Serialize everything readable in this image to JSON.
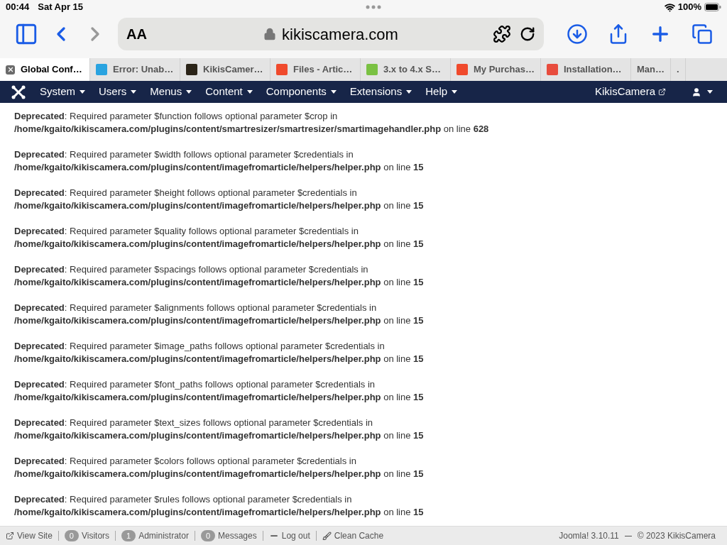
{
  "status_bar": {
    "time": "00:44",
    "date": "Sat Apr 15",
    "battery": "100%"
  },
  "browser": {
    "text_size": "AA",
    "address": "kikiscamera.com"
  },
  "tabs": [
    {
      "label": "Global Conf…",
      "selected": true,
      "color": "#6b6b6b"
    },
    {
      "label": "Error: Unab…",
      "selected": false,
      "color": "#29a3e0"
    },
    {
      "label": "KikisCamer…",
      "selected": false,
      "color": "#2b2418"
    },
    {
      "label": "Files - Artic…",
      "selected": false,
      "color": "#f04a2c"
    },
    {
      "label": "3.x to 4.x S…",
      "selected": false,
      "color": "#7ac143"
    },
    {
      "label": "My Purchas…",
      "selected": false,
      "color": "#f04a2c"
    },
    {
      "label": "Installation…",
      "selected": false,
      "color": "#e84c3d"
    },
    {
      "label": "Man…",
      "selected": false
    },
    {
      "label": ".",
      "selected": false
    }
  ],
  "admin_menu": {
    "items": [
      "System",
      "Users",
      "Menus",
      "Content",
      "Components",
      "Extensions",
      "Help"
    ],
    "site_link": "KikisCamera"
  },
  "messages": [
    {
      "text": "**Deprecated**: Required parameter $function follows optional parameter $crop in",
      "location": "**/home/kgaito/kikiscamera.com/plugins/content/smartresizer/smartresizer/smartimagehandler.php** on line **628**"
    },
    {
      "text": "**Deprecated**: Required parameter $width follows optional parameter $credentials in",
      "location": "**/home/kgaito/kikiscamera.com/plugins/content/imagefromarticle/helpers/helper.php** on line **15**"
    },
    {
      "text": "**Deprecated**: Required parameter $height follows optional parameter $credentials in",
      "location": "**/home/kgaito/kikiscamera.com/plugins/content/imagefromarticle/helpers/helper.php** on line **15**"
    },
    {
      "text": "**Deprecated**: Required parameter $quality follows optional parameter $credentials in",
      "location": "**/home/kgaito/kikiscamera.com/plugins/content/imagefromarticle/helpers/helper.php** on line **15**"
    },
    {
      "text": "**Deprecated**: Required parameter $spacings follows optional parameter $credentials in",
      "location": "**/home/kgaito/kikiscamera.com/plugins/content/imagefromarticle/helpers/helper.php** on line **15**"
    },
    {
      "text": "**Deprecated**: Required parameter $alignments follows optional parameter $credentials in",
      "location": "**/home/kgaito/kikiscamera.com/plugins/content/imagefromarticle/helpers/helper.php** on line **15**"
    },
    {
      "text": "**Deprecated**: Required parameter $image_paths follows optional parameter $credentials in",
      "location": "**/home/kgaito/kikiscamera.com/plugins/content/imagefromarticle/helpers/helper.php** on line **15**"
    },
    {
      "text": "**Deprecated**: Required parameter $font_paths follows optional parameter $credentials in",
      "location": "**/home/kgaito/kikiscamera.com/plugins/content/imagefromarticle/helpers/helper.php** on line **15**"
    },
    {
      "text": "**Deprecated**: Required parameter $text_sizes follows optional parameter $credentials in",
      "location": "**/home/kgaito/kikiscamera.com/plugins/content/imagefromarticle/helpers/helper.php** on line **15**"
    },
    {
      "text": "**Deprecated**: Required parameter $colors follows optional parameter $credentials in",
      "location": "**/home/kgaito/kikiscamera.com/plugins/content/imagefromarticle/helpers/helper.php** on line **15**"
    },
    {
      "text": "**Deprecated**: Required parameter $rules follows optional parameter $credentials in",
      "location": "**/home/kgaito/kikiscamera.com/plugins/content/imagefromarticle/helpers/helper.php** on line **15**"
    }
  ],
  "footer": {
    "items": [
      {
        "kind": "link",
        "label": "View Site"
      },
      {
        "kind": "count",
        "count": "0",
        "label": "Visitors"
      },
      {
        "kind": "count",
        "count": "1",
        "label": "Administrator"
      },
      {
        "kind": "count",
        "count": "0",
        "label": "Messages"
      },
      {
        "kind": "logout",
        "label": "Log out"
      },
      {
        "kind": "cache",
        "label": "Clean Cache"
      }
    ],
    "version": "Joomla! 3.10.11",
    "copyright": "© 2023 KikisCamera"
  }
}
